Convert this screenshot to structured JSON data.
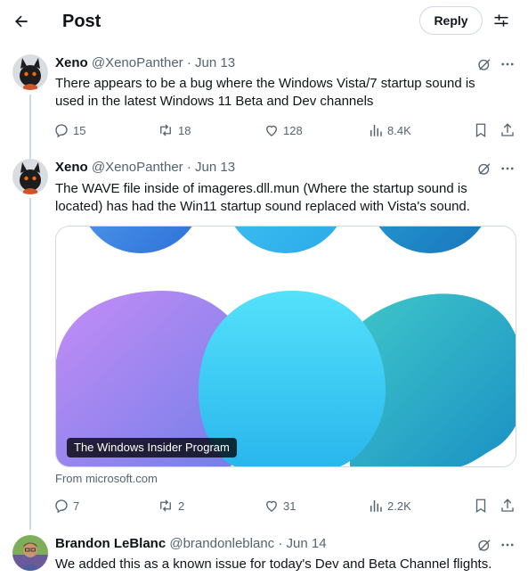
{
  "header": {
    "title": "Post",
    "reply_label": "Reply"
  },
  "posts": [
    {
      "name": "Xeno",
      "handle": "@XenoPanther",
      "date": "Jun 13",
      "text": "There appears to be a bug where the Windows Vista/7 startup sound is used in the latest Windows 11 Beta and Dev channels",
      "replies": "15",
      "reposts": "18",
      "likes": "128",
      "views": "8.4K"
    },
    {
      "name": "Xeno",
      "handle": "@XenoPanther",
      "date": "Jun 13",
      "text": "The WAVE file inside of imageres.dll.mun (Where the startup sound is located) has had the Win11 startup sound replaced with Vista's sound.",
      "card": {
        "badge": "The Windows Insider Program",
        "source": "From microsoft.com"
      },
      "replies": "7",
      "reposts": "2",
      "likes": "31",
      "views": "2.2K"
    },
    {
      "name": "Brandon LeBlanc",
      "handle": "@brandonleblanc",
      "date": "Jun 14",
      "text": "We added this as a known issue for today's Dev and Beta Channel flights."
    }
  ],
  "separator": "·",
  "icons": {
    "back": "arrow-left-icon",
    "filter": "sliders-icon",
    "grok": "grok-icon",
    "more": "more-icon",
    "reply": "reply-icon",
    "repost": "repost-icon",
    "like": "heart-icon",
    "views": "views-icon",
    "bookmark": "bookmark-icon",
    "share": "share-icon"
  },
  "colors": {
    "text": "#0f1419",
    "secondary": "#536471",
    "border": "#cfd9de"
  }
}
